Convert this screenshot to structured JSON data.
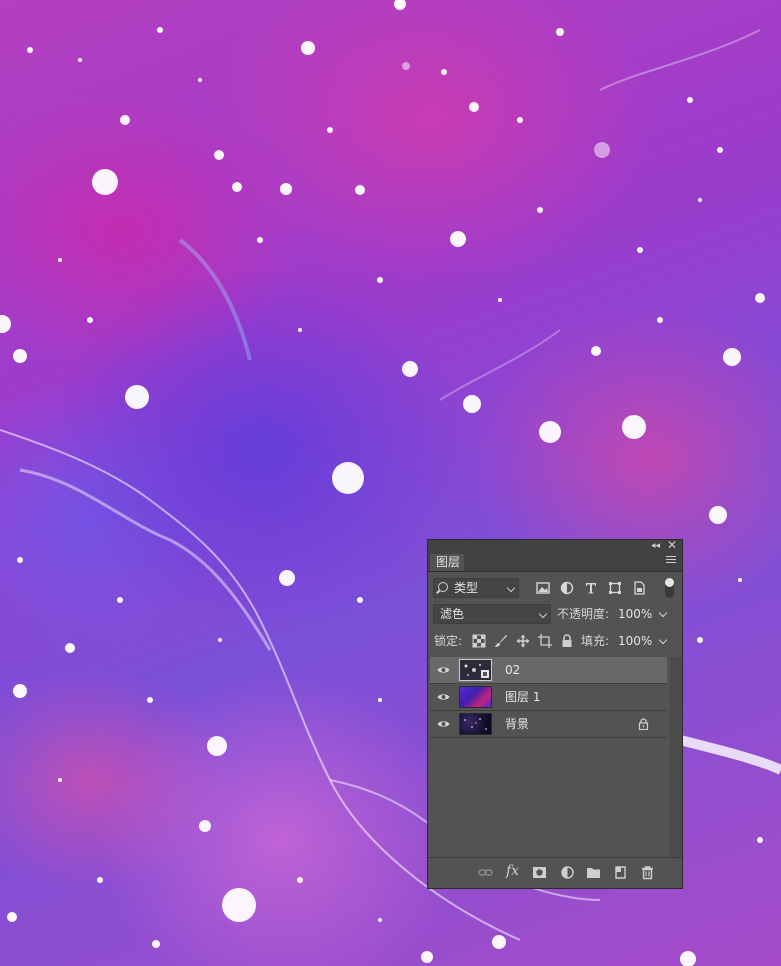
{
  "panel": {
    "tab_label": "图层",
    "collapse_glyph": "◂◂",
    "close_glyph": "✕",
    "filter": {
      "kind_label": "类型",
      "icons": [
        "image-filter-icon",
        "adjustment-filter-icon",
        "type-filter-icon",
        "shape-filter-icon",
        "smart-object-filter-icon"
      ]
    },
    "blend_mode": "滤色",
    "opacity_label": "不透明度:",
    "opacity_value": "100%",
    "lock_label": "锁定:",
    "fill_label": "填充:",
    "fill_value": "100%",
    "layers": [
      {
        "name": "02",
        "selected": true,
        "visible": true
      },
      {
        "name": "图层 1",
        "selected": false,
        "visible": true
      },
      {
        "name": "背景",
        "selected": false,
        "visible": true,
        "locked": true
      }
    ],
    "fx_label": "fx",
    "colors": {
      "panel_bg": "#535353",
      "selected_row": "#696969",
      "header_bg": "#424242"
    }
  }
}
